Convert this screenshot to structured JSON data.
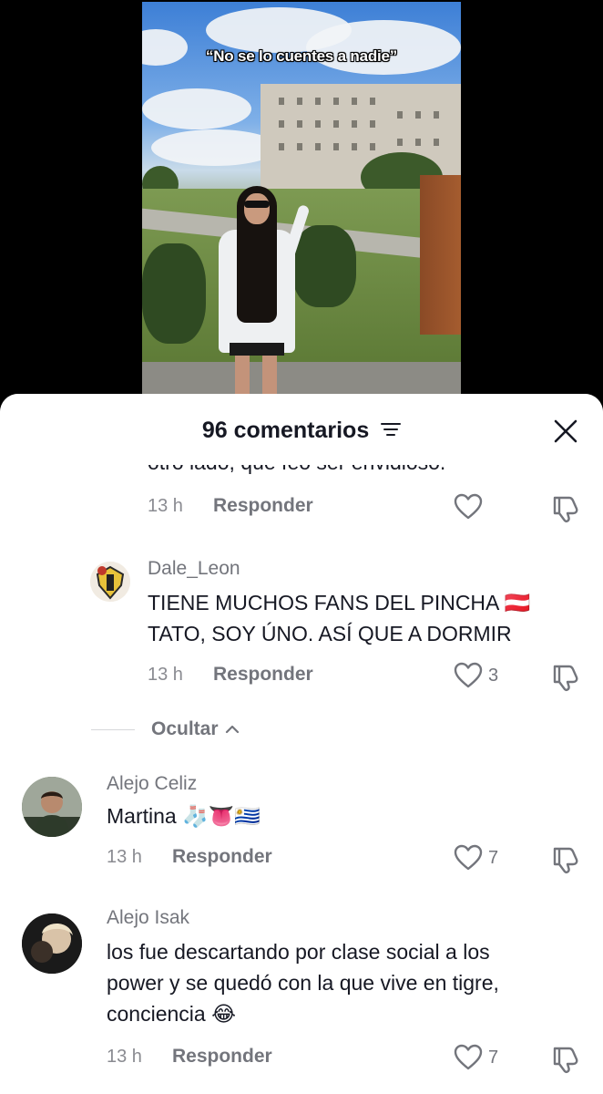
{
  "video": {
    "caption": "“No se lo cuentes a nadie”"
  },
  "sheet": {
    "title": "96 comentarios",
    "filter_icon": "filter-lines-icon",
    "close_icon": "close-x-icon"
  },
  "truncated_comment": {
    "text": "otro lado, que feo ser envidioso.",
    "time": "13 h",
    "reply_label": "Responder",
    "likes": ""
  },
  "comments": [
    {
      "username": "Dale_Leon",
      "lines": [
        "TIENE MUCHOS FANS DEL PINCHA 🇦🇹",
        "TATO, SOY ÚNO. ASÍ QUE A DORMIR"
      ],
      "time": "13 h",
      "reply_label": "Responder",
      "likes": "3"
    },
    {
      "username": "Alejo Celiz",
      "lines": [
        "Martina 🧦👅🇺🇾"
      ],
      "time": "13 h",
      "reply_label": "Responder",
      "likes": "7"
    },
    {
      "username": "Alejo Isak",
      "lines": [
        "los fue descartando por clase social a los",
        "power y se quedó con la que vive en tigre,",
        "conciencia 😂"
      ],
      "time": "13 h",
      "reply_label": "Responder",
      "likes": "7"
    }
  ],
  "hide_replies": {
    "label": "Ocultar"
  },
  "colors": {
    "text_primary": "#161823",
    "text_secondary": "#73757c",
    "sheet_bg": "#ffffff"
  }
}
